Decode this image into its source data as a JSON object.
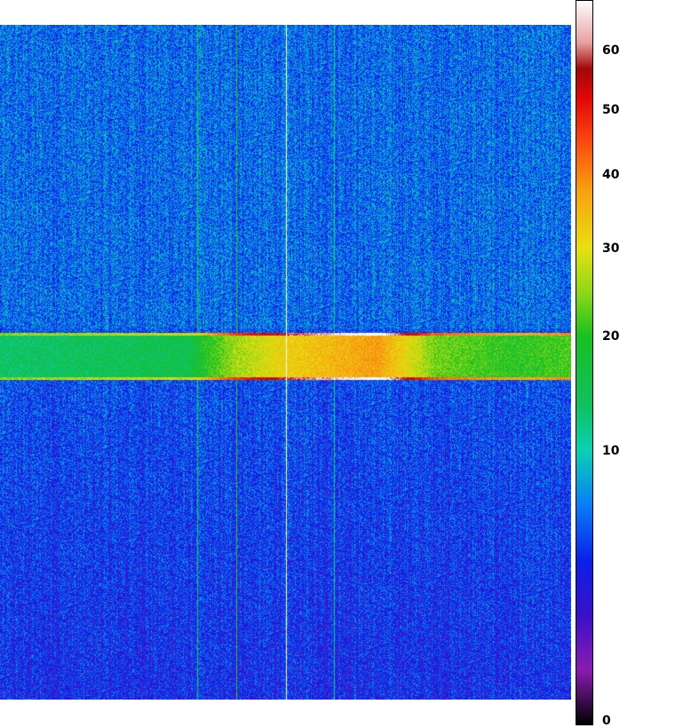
{
  "chart_data": {
    "type": "heatmap",
    "title": "",
    "xlabel": "",
    "ylabel": "",
    "colorbar": {
      "scale": "nonlinear",
      "range": [
        0,
        66
      ],
      "ticks": [
        "0",
        "10",
        "20",
        "30",
        "40",
        "50",
        "60"
      ],
      "colormap": [
        {
          "v": 0,
          "color": "#000000"
        },
        {
          "v": 2,
          "color": "#8a1cb0"
        },
        {
          "v": 4,
          "color": "#3a10c8"
        },
        {
          "v": 6,
          "color": "#0a20e8"
        },
        {
          "v": 8,
          "color": "#0a7cf8"
        },
        {
          "v": 10,
          "color": "#0ad0b4"
        },
        {
          "v": 14,
          "color": "#10c060"
        },
        {
          "v": 20,
          "color": "#18c020"
        },
        {
          "v": 25,
          "color": "#8cd818"
        },
        {
          "v": 30,
          "color": "#e8e010"
        },
        {
          "v": 38,
          "color": "#f8a010"
        },
        {
          "v": 46,
          "color": "#f84010"
        },
        {
          "v": 52,
          "color": "#e00808"
        },
        {
          "v": 57,
          "color": "#a00808"
        },
        {
          "v": 61,
          "color": "#e8a0a0"
        },
        {
          "v": 66,
          "color": "#ffffff"
        }
      ]
    },
    "background_level": 7,
    "bright_band": {
      "rows": [
        0.456,
        0.526
      ],
      "level_profile": [
        {
          "x": 0.0,
          "v": 14
        },
        {
          "x": 0.33,
          "v": 16
        },
        {
          "x": 0.41,
          "v": 26
        },
        {
          "x": 0.5,
          "v": 32
        },
        {
          "x": 0.66,
          "v": 38
        },
        {
          "x": 0.76,
          "v": 24
        },
        {
          "x": 0.9,
          "v": 20
        },
        {
          "x": 1.0,
          "v": 22
        }
      ]
    },
    "vertical_streaks": [
      {
        "col": 0.345,
        "level": 14
      },
      {
        "col": 0.413,
        "level": 20
      },
      {
        "col": 0.5,
        "level": 66
      },
      {
        "col": 0.585,
        "level": 12
      }
    ]
  }
}
